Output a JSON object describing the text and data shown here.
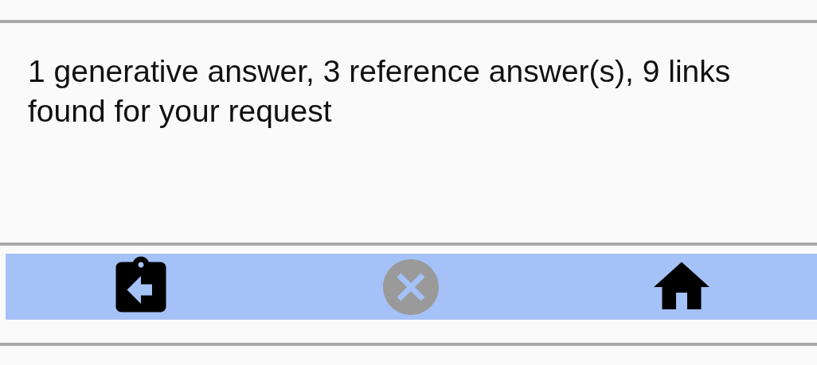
{
  "message": "1 generative answer, 3 reference answer(s), 9 links found for your request",
  "toolbar": {
    "buttons": [
      {
        "kind": "back",
        "disabled": false
      },
      {
        "kind": "cancel",
        "disabled": true
      },
      {
        "kind": "home",
        "disabled": false
      }
    ]
  }
}
